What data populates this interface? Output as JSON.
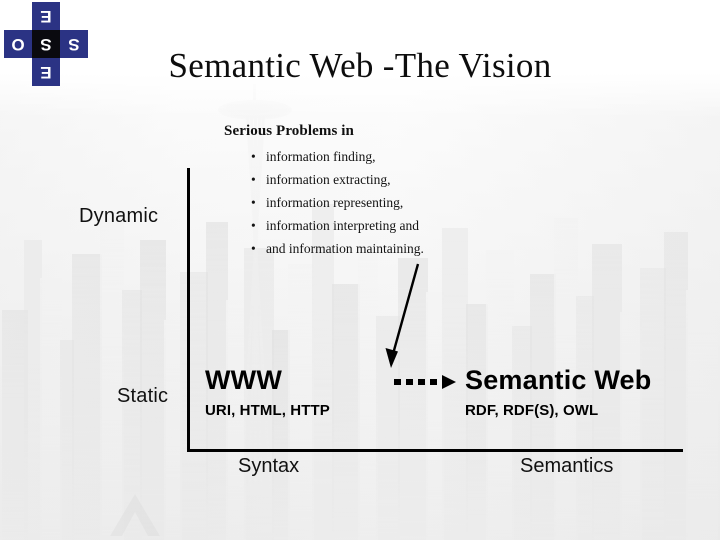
{
  "slide": {
    "title": "Semantic Web -The Vision",
    "background_color": "#ececec",
    "background_scene": "city-skyline-space-needle"
  },
  "logo": {
    "name": "cross-logo",
    "brand_color": "#2b3384",
    "center_color": "#0a0a0f",
    "letters": {
      "top": "E",
      "left": "O",
      "center": "S",
      "right": "S",
      "bottom": "E"
    }
  },
  "problems": {
    "heading": "Serious Problems in",
    "bullet_glyph": "•",
    "items": [
      "information finding,",
      "information extracting,",
      "information representing,",
      "information interpreting and",
      "and information maintaining."
    ]
  },
  "axes": {
    "y_top_label": "Dynamic",
    "y_bottom_label": "Static",
    "x_left_label": "Syntax",
    "x_right_label": "Semantics",
    "line_color": "#000000"
  },
  "blocks": [
    {
      "id": "www",
      "title": "WWW",
      "subtitle": "URI, HTML, HTTP"
    },
    {
      "id": "semantic-web",
      "title": "Semantic Web",
      "subtitle": "RDF, RDF(S), OWL"
    }
  ],
  "connectors": {
    "dotted_arrow": {
      "name": "dotted-right-arrow",
      "dot_count": 4,
      "direction": "right"
    },
    "diagonal_arrow": {
      "name": "diagonal-down-arrow",
      "direction": "down"
    }
  }
}
